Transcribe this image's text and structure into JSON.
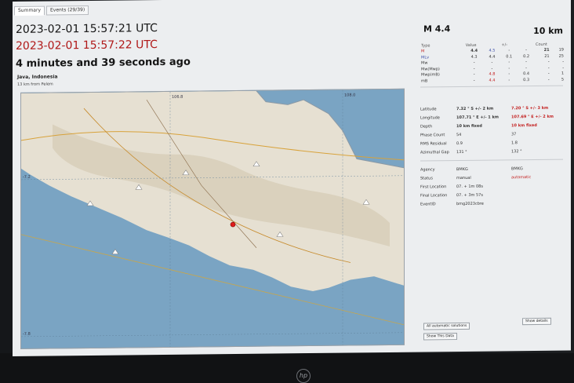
{
  "tabs": [
    "Summary",
    "Events (29/39)"
  ],
  "summary": {
    "origin_time": "2023-02-01 15:57:21 UTC",
    "update_time": "2023-02-01 15:57:22 UTC",
    "elapsed": "4 minutes and 39 seconds ago",
    "region": "Java, Indonesia",
    "distance": "13 km from Pelem"
  },
  "event": {
    "magnitude": "M 4.4",
    "depth": "10 km"
  },
  "mag_table": {
    "headers": [
      "Type",
      "Value",
      "+/-",
      "Count"
    ],
    "rows": [
      {
        "type": "M",
        "v1": "4.4",
        "v2": "4.5",
        "e1": "-",
        "e2": "-",
        "c1": "21",
        "c2": "19"
      },
      {
        "type": "MLv",
        "v1": "4.3",
        "v2": "4.4",
        "e1": "0.1",
        "e2": "0.2",
        "c1": "21",
        "c2": "25"
      },
      {
        "type": "Mw",
        "v1": "-",
        "v2": "-",
        "e1": "-",
        "e2": "-",
        "c1": "-",
        "c2": "-"
      },
      {
        "type": "Mw(Mwp)",
        "v1": "-",
        "v2": "-",
        "e1": "-",
        "e2": "-",
        "c1": "-",
        "c2": "-"
      },
      {
        "type": "Mwp(mB)",
        "v1": "-",
        "v2": "4.8",
        "e1": "-",
        "e2": "0.4",
        "c1": "-",
        "c2": "1"
      },
      {
        "type": "mB",
        "v1": "-",
        "v2": "4.4",
        "e1": "-",
        "e2": "0.3",
        "c1": "-",
        "c2": "5"
      }
    ]
  },
  "location": {
    "latitude_label": "Latitude",
    "latitude_v1": "7.32 ° S  +/- 2 km",
    "latitude_v2": "7.20 ° S  +/- 3 km",
    "longitude_label": "Longitude",
    "longitude_v1": "107.71 ° E  +/- 1 km",
    "longitude_v2": "107.69 ° E  +/- 2 km",
    "depth_label": "Depth",
    "depth_v1": "10 km  fixed",
    "depth_v2": "10 km  fixed",
    "phase_label": "Phase Count",
    "phase_v1": "54",
    "phase_v2": "37",
    "rms_label": "RMS Residual",
    "rms_v1": "0.9",
    "rms_v2": "1.8",
    "gap_label": "Azimuthal Gap",
    "gap_v1": "131 °",
    "gap_v2": "132 °"
  },
  "info": {
    "agency_label": "Agency",
    "agency_v1": "BMKG",
    "agency_v2": "BMKG",
    "status_label": "Status",
    "status_v1": "manual",
    "status_v2": "automatic",
    "first_label": "First Location",
    "first_v1": "07. + 1m 08s",
    "final_label": "Final Location",
    "final_v1": "07. + 3m 57s",
    "eventid_label": "EventID",
    "eventid_v1": "bmg2023cbre"
  },
  "buttons": {
    "show_solutions": "All automatic solutions",
    "show_details": "Show details",
    "show_data": "Show This Data"
  },
  "map": {
    "grid_labels": [
      "106.8",
      "108.0",
      "-7.2",
      "-7.8"
    ]
  },
  "colors": {
    "sea": "#7aa4c3",
    "land": "#e6e0d2",
    "epicenter": "#e01b1b",
    "red_text": "#b01818"
  }
}
